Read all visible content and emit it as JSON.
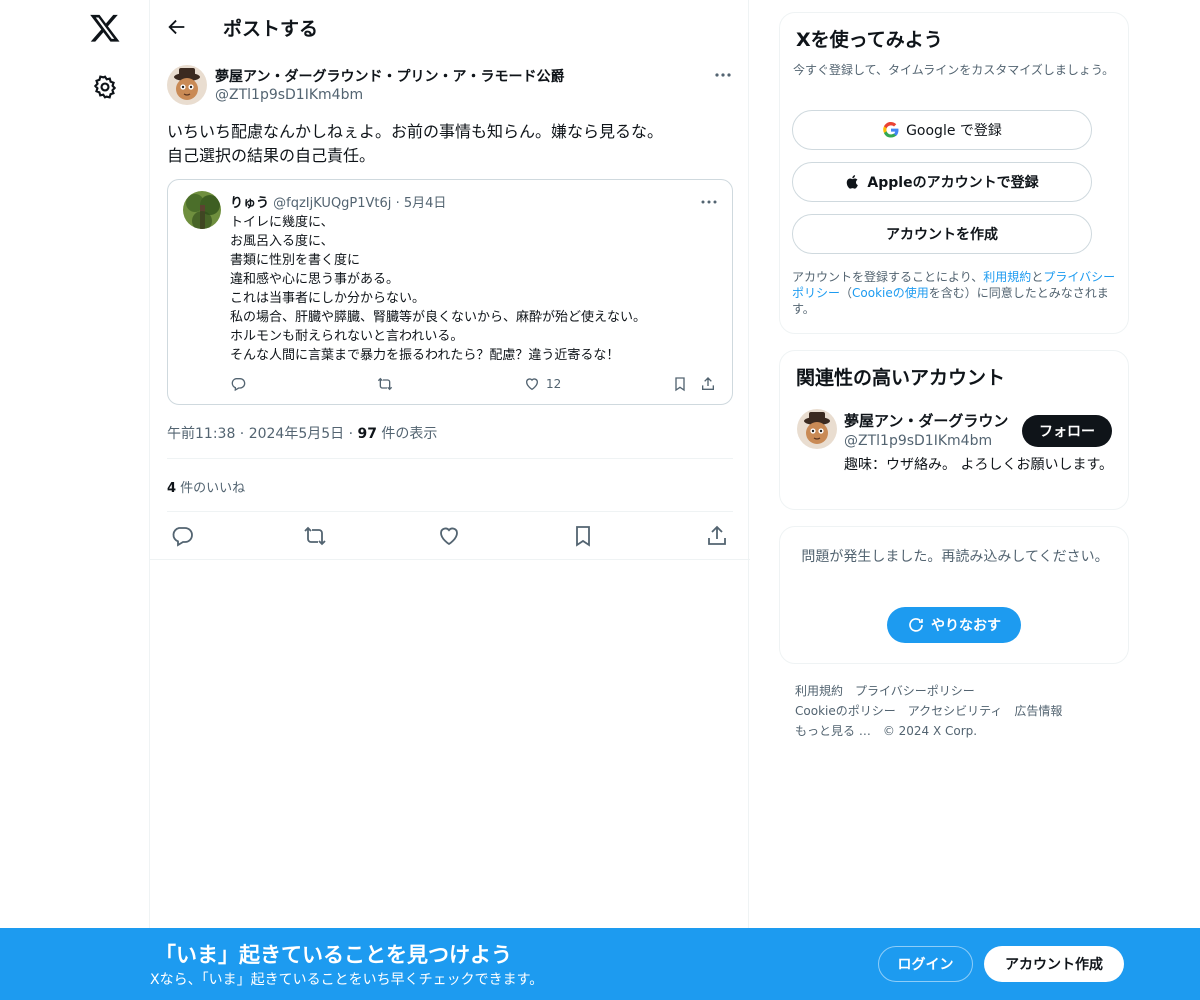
{
  "header": {
    "title": "ポストする"
  },
  "post": {
    "author_name": "夢屋アン・ダーグラウンド・プリン・ア・ラモード公爵",
    "author_handle": "@ZTl1p9sD1IKm4bm",
    "text": "いちいち配慮なんかしねぇよ。お前の事情も知らん。嫌なら見るな。\n自己選択の結果の自己責任。",
    "quote": {
      "name": "りゅう",
      "handle": "@fqzIjKUQgP1Vt6j",
      "date": "· 5月4日",
      "text": "トイレに幾度に、\nお風呂入る度に、\n書類に性別を書く度に\n違和感や心に思う事がある。\nこれは当事者にしか分からない。\n私の場合、肝臓や膵臓、腎臓等が良くないから、麻酔が殆ど使えない。\nホルモンも耐えられないと言われいる。\nそんな人間に言葉まで暴力を振るわれたら？配慮？違う近寄るな！",
      "like_count": "12"
    },
    "time": "午前11:38 · 2024年5月5日 · ",
    "views_count": "97",
    "views_label": " 件の表示",
    "likes_count": "4",
    "likes_label": " 件のいいね"
  },
  "signup_card": {
    "title": "Xを使ってみよう",
    "subtitle": "今すぐ登録して、タイムラインをカスタマイズしましょう。",
    "google_label": "Google で登録",
    "apple_label": "Appleのアカウントで登録",
    "create_label": "アカウントを作成",
    "legal_1": "アカウントを登録することにより、",
    "legal_terms": "利用規約",
    "legal_2": "と",
    "legal_privacy": "プライバシーポリシー",
    "legal_3": "（",
    "legal_cookie": "Cookieの使用",
    "legal_4": "を含む）に同意したとみなされます。"
  },
  "relevant": {
    "title": "関連性の高いアカウント",
    "name": "夢屋アン・ダーグラウン",
    "handle": "@ZTl1p9sD1IKm4bm",
    "follow_label": "フォロー",
    "bio": "趣味：ウザ絡み。 よろしくお願いします。"
  },
  "error_card": {
    "message": "問題が発生しました。再読み込みしてください。",
    "retry_label": "やりなおす"
  },
  "footer": {
    "terms": "利用規約",
    "privacy": "プライバシーポリシー",
    "cookie": "Cookieのポリシー",
    "accessibility": "アクセシビリティ",
    "ads": "広告情報",
    "more": "もっと見る …",
    "copyright": "© 2024 X Corp."
  },
  "banner": {
    "title": "「いま」起きていることを見つけよう",
    "subtitle": "Xなら、「いま」起きていることをいち早くチェックできます。",
    "login_label": "ログイン",
    "signup_label": "アカウント作成"
  },
  "colors": {
    "accent": "#1d9bf0",
    "text": "#0f1419",
    "secondary": "#536471",
    "border": "#eff3f4"
  }
}
